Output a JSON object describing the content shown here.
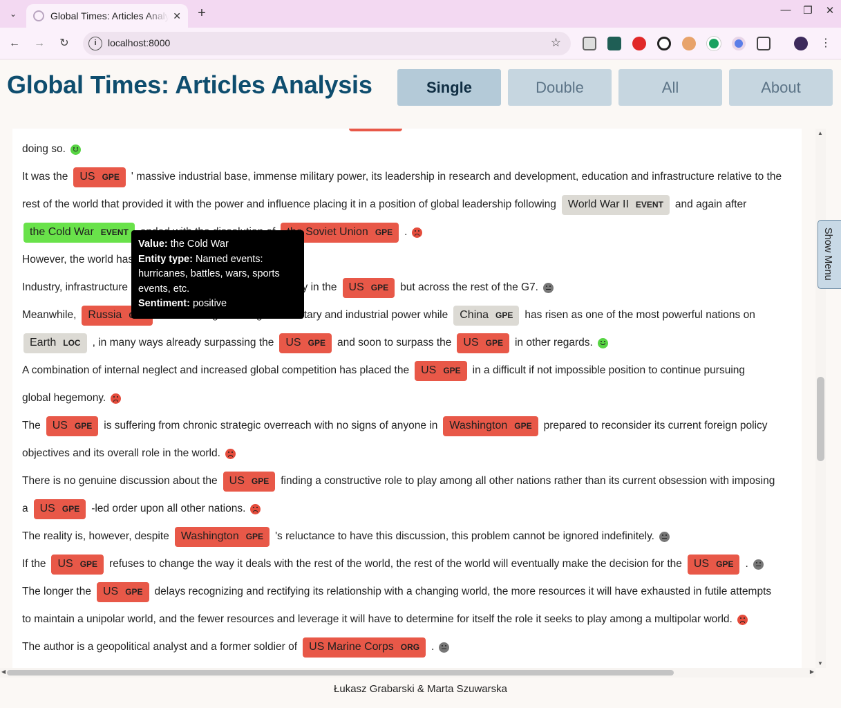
{
  "browser": {
    "tab_title": "Global Times: Articles Analysis",
    "url": "localhost:8000"
  },
  "app": {
    "title": "Global Times: Articles Analysis",
    "nav": [
      {
        "label": "Single",
        "active": true
      },
      {
        "label": "Double",
        "active": false
      },
      {
        "label": "All",
        "active": false
      },
      {
        "label": "About",
        "active": false
      }
    ],
    "show_menu": "Show Menu",
    "footer": "Łukasz Grabarski & Marta Szuwarska"
  },
  "article": {
    "lines": [
      [
        {
          "t": "doing so."
        },
        {
          "emo": "positive"
        }
      ],
      [
        {
          "t": "It was the"
        },
        {
          "ent": "US",
          "label": "GPE",
          "s": "negative"
        },
        {
          "t": "' massive industrial base, immense military power, its leadership in research and development, education and infrastructure relative to the"
        }
      ],
      [
        {
          "t": "rest of the world that provided it with the power and influence placing it in a position of global leadership following"
        },
        {
          "ent": "World War II",
          "label": "EVENT",
          "s": "neutral"
        },
        {
          "t": "and again after"
        }
      ],
      [
        {
          "ent": "the Cold War",
          "label": "EVENT",
          "s": "positive"
        },
        {
          "t": "ended with the dissolution of"
        },
        {
          "ent": "the Soviet Union",
          "label": "GPE",
          "s": "negative"
        },
        {
          "t": "."
        },
        {
          "emo": "negative"
        }
      ],
      [
        {
          "t": "However, the world has changed."
        }
      ],
      [
        {
          "t": "Industry, infrastructure and education have declined not only in the"
        },
        {
          "ent": "US",
          "label": "GPE",
          "s": "negative"
        },
        {
          "t": "but across the rest of the G7."
        },
        {
          "emo": "neutral"
        }
      ],
      [
        {
          "t": "Meanwhile,"
        },
        {
          "ent": "Russia",
          "label": "GPE",
          "s": "negative"
        },
        {
          "t": "has reemerged as a global military and industrial power while"
        },
        {
          "ent": "China",
          "label": "GPE",
          "s": "neutral"
        },
        {
          "t": "has risen as one of the most powerful nations on"
        }
      ],
      [
        {
          "ent": "Earth",
          "label": "LOC",
          "s": "neutral"
        },
        {
          "t": ", in many ways already surpassing the"
        },
        {
          "ent": "US",
          "label": "GPE",
          "s": "negative"
        },
        {
          "t": "and soon to surpass the"
        },
        {
          "ent": "US",
          "label": "GPE",
          "s": "negative"
        },
        {
          "t": "in other regards."
        },
        {
          "emo": "positive"
        }
      ],
      [
        {
          "t": "A combination of internal neglect and increased global competition has placed the"
        },
        {
          "ent": "US",
          "label": "GPE",
          "s": "negative"
        },
        {
          "t": "in a difficult if not impossible position to continue pursuing"
        }
      ],
      [
        {
          "t": "global hegemony."
        },
        {
          "emo": "negative"
        }
      ],
      [
        {
          "t": "The"
        },
        {
          "ent": "US",
          "label": "GPE",
          "s": "negative"
        },
        {
          "t": "is suffering from chronic strategic overreach with no signs of anyone in"
        },
        {
          "ent": "Washington",
          "label": "GPE",
          "s": "negative"
        },
        {
          "t": "prepared to reconsider its current foreign policy"
        }
      ],
      [
        {
          "t": "objectives and its overall role in the world."
        },
        {
          "emo": "negative"
        }
      ],
      [
        {
          "t": "There is no genuine discussion about the"
        },
        {
          "ent": "US",
          "label": "GPE",
          "s": "negative"
        },
        {
          "t": "finding a constructive role to play among all other nations rather than its current obsession with imposing"
        }
      ],
      [
        {
          "t": "a"
        },
        {
          "ent": "US",
          "label": "GPE",
          "s": "negative"
        },
        {
          "t": "-led order upon all other nations."
        },
        {
          "emo": "negative"
        }
      ],
      [
        {
          "t": "The reality is, however, despite"
        },
        {
          "ent": "Washington",
          "label": "GPE",
          "s": "negative"
        },
        {
          "t": "'s reluctance to have this discussion, this problem cannot be ignored indefinitely."
        },
        {
          "emo": "neutral"
        }
      ],
      [
        {
          "t": "If the"
        },
        {
          "ent": "US",
          "label": "GPE",
          "s": "negative"
        },
        {
          "t": "refuses to change the way it deals with the rest of the world, the rest of the world will eventually make the decision for the"
        },
        {
          "ent": "US",
          "label": "GPE",
          "s": "negative"
        },
        {
          "t": "."
        },
        {
          "emo": "neutral"
        }
      ],
      [
        {
          "t": "The longer the"
        },
        {
          "ent": "US",
          "label": "GPE",
          "s": "negative"
        },
        {
          "t": "delays recognizing and rectifying its relationship with a changing world, the more resources it will have exhausted in futile attempts"
        }
      ],
      [
        {
          "t": "to maintain a unipolar world, and the fewer resources and leverage it will have to determine for itself the role it seeks to play among a multipolar world."
        },
        {
          "emo": "negative"
        }
      ],
      [
        {
          "t": "The author is a geopolitical analyst and a former soldier of"
        },
        {
          "ent": "US Marine Corps",
          "label": "ORG",
          "s": "negative"
        },
        {
          "t": "."
        },
        {
          "emo": "neutral"
        }
      ]
    ]
  },
  "tooltip": {
    "value_label": "Value:",
    "value": "the Cold War",
    "type_label": "Entity type:",
    "type": "Named events: hurricanes, battles, wars, sports events, etc.",
    "sentiment_label": "Sentiment:",
    "sentiment": "positive"
  },
  "colors": {
    "title": "#0e4d6e",
    "negative": "#e85848",
    "neutral": "#dcdad4",
    "positive": "#69e24a"
  }
}
